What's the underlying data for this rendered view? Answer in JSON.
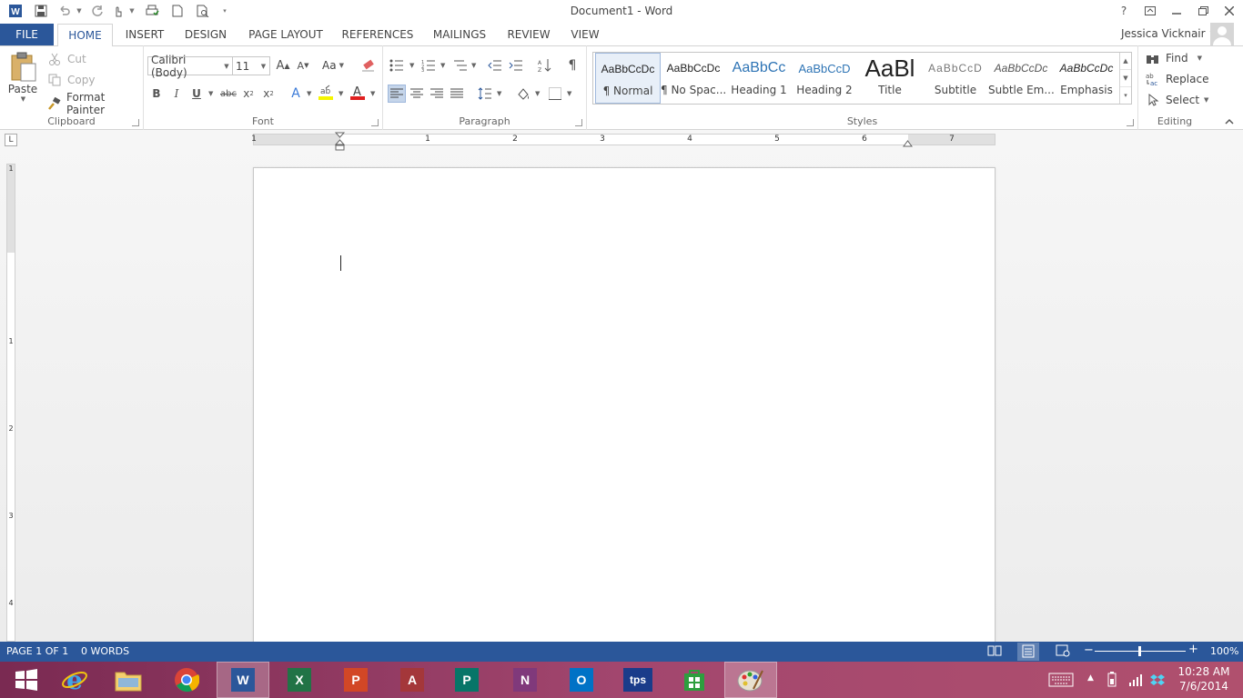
{
  "window": {
    "title": "Document1 - Word",
    "help": "?",
    "user_name": "Jessica Vicknair"
  },
  "tabs": [
    {
      "label": "FILE"
    },
    {
      "label": "HOME"
    },
    {
      "label": "INSERT"
    },
    {
      "label": "DESIGN"
    },
    {
      "label": "PAGE LAYOUT"
    },
    {
      "label": "REFERENCES"
    },
    {
      "label": "MAILINGS"
    },
    {
      "label": "REVIEW"
    },
    {
      "label": "VIEW"
    }
  ],
  "clipboard": {
    "paste": "Paste",
    "cut": "Cut",
    "copy": "Copy",
    "format_painter": "Format Painter",
    "label": "Clipboard"
  },
  "font": {
    "family": "Calibri (Body)",
    "size": "11",
    "label": "Font",
    "change_case": "Aa"
  },
  "paragraph": {
    "label": "Paragraph"
  },
  "styles": {
    "label": "Styles",
    "items": [
      {
        "preview": "AaBbCcDc",
        "name": "¶ Normal"
      },
      {
        "preview": "AaBbCcDc",
        "name": "¶ No Spac..."
      },
      {
        "preview": "AaBbCc",
        "name": "Heading 1"
      },
      {
        "preview": "AaBbCcD",
        "name": "Heading 2"
      },
      {
        "preview": "AaBl",
        "name": "Title"
      },
      {
        "preview": "AaBbCcD",
        "name": "Subtitle"
      },
      {
        "preview": "AaBbCcDc",
        "name": "Subtle Em..."
      },
      {
        "preview": "AaBbCcDc",
        "name": "Emphasis"
      }
    ]
  },
  "editing": {
    "find": "Find",
    "replace": "Replace",
    "select": "Select",
    "label": "Editing"
  },
  "ruler": {
    "h_numbers": [
      "1",
      "1",
      "2",
      "3",
      "4",
      "5",
      "6",
      "7"
    ],
    "v_numbers": [
      "1",
      "1",
      "2",
      "3",
      "4"
    ],
    "corner": "L"
  },
  "status": {
    "page": "PAGE 1 OF 1",
    "words": "0 WORDS",
    "zoom": "100%"
  },
  "taskbar": {
    "time": "10:28 AM",
    "date": "7/6/2014",
    "tps": "tps"
  },
  "colors": {
    "accent": "#2b579a",
    "taskbar": "#a2466e"
  }
}
